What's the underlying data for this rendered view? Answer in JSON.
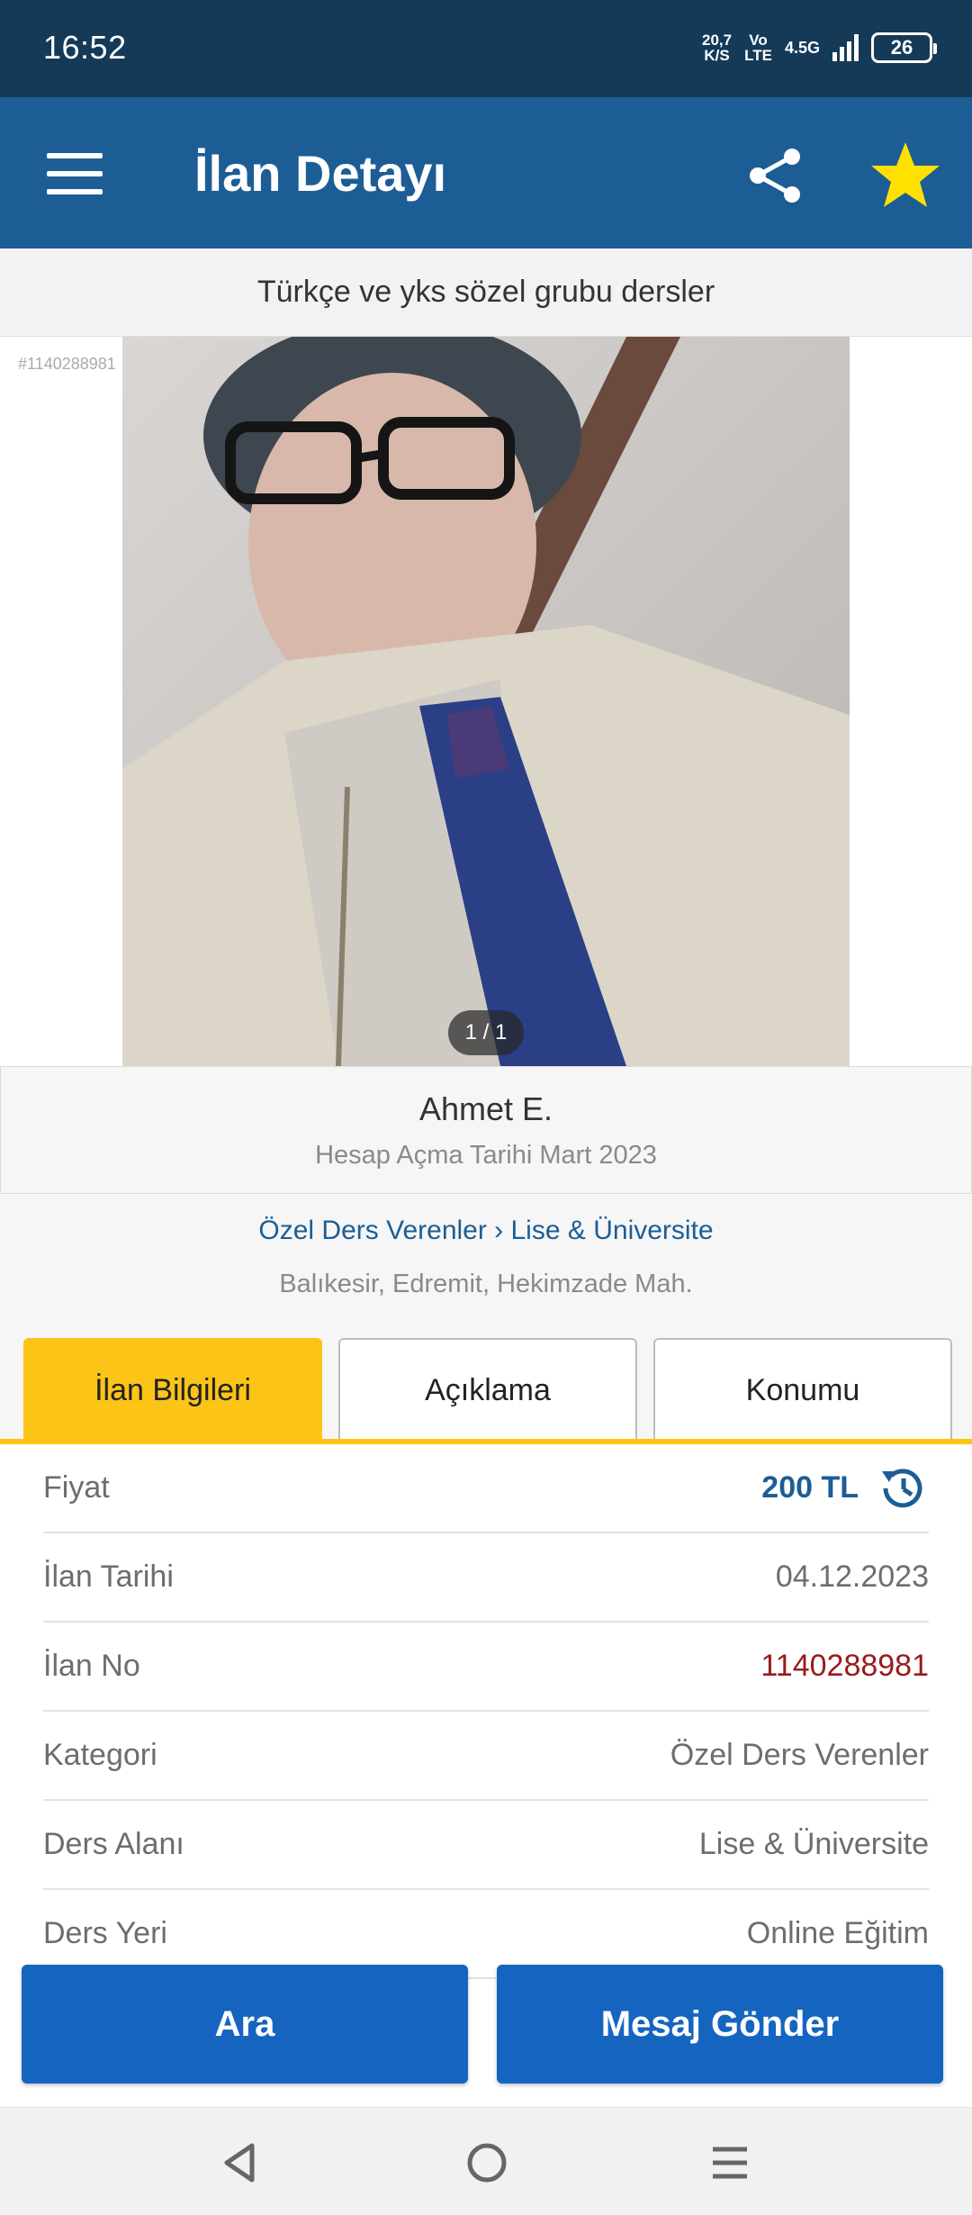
{
  "status_bar": {
    "time": "16:52",
    "net_speed_value": "20,7",
    "net_speed_unit": "K/S",
    "volte_top": "Vo",
    "volte_bottom": "LTE",
    "network": "4.5G",
    "battery": "26"
  },
  "app_bar": {
    "title": "İlan Detayı",
    "menu_icon": "menu-icon",
    "share_icon": "share-icon",
    "favorite_icon": "star-icon",
    "favorite_color": "#ffe100"
  },
  "listing": {
    "title": "Türkçe ve yks sözel grubu dersler",
    "photo_id": "#1140288981",
    "photo_counter": "1 / 1"
  },
  "seller": {
    "name": "Ahmet E.",
    "since": "Hesap Açma Tarihi  Mart 2023"
  },
  "category": {
    "breadcrumb": "Özel Ders Verenler › Lise & Üniversite",
    "location": "Balıkesir, Edremit, Hekimzade Mah."
  },
  "tabs": [
    {
      "label": "İlan Bilgileri",
      "active": true
    },
    {
      "label": "Açıklama",
      "active": false
    },
    {
      "label": "Konumu",
      "active": false
    }
  ],
  "details": {
    "price_label": "Fiyat",
    "price_value": "200 TL",
    "date_label": "İlan Tarihi",
    "date_value": "04.12.2023",
    "id_label": "İlan No",
    "id_value": "1140288981",
    "category_label": "Kategori",
    "category_value": "Özel Ders Verenler",
    "field_label": "Ders Alanı",
    "field_value": "Lise & Üniversite",
    "place_label": "Ders Yeri",
    "place_value": "Online Eğitim"
  },
  "actions": {
    "call": "Ara",
    "message": "Mesaj Gönder"
  },
  "colors": {
    "status_bar": "#143a58",
    "app_bar": "#1c5d96",
    "accent_tab": "#fcc417",
    "button": "#1565c0",
    "listing_id": "#9a1b1b"
  }
}
